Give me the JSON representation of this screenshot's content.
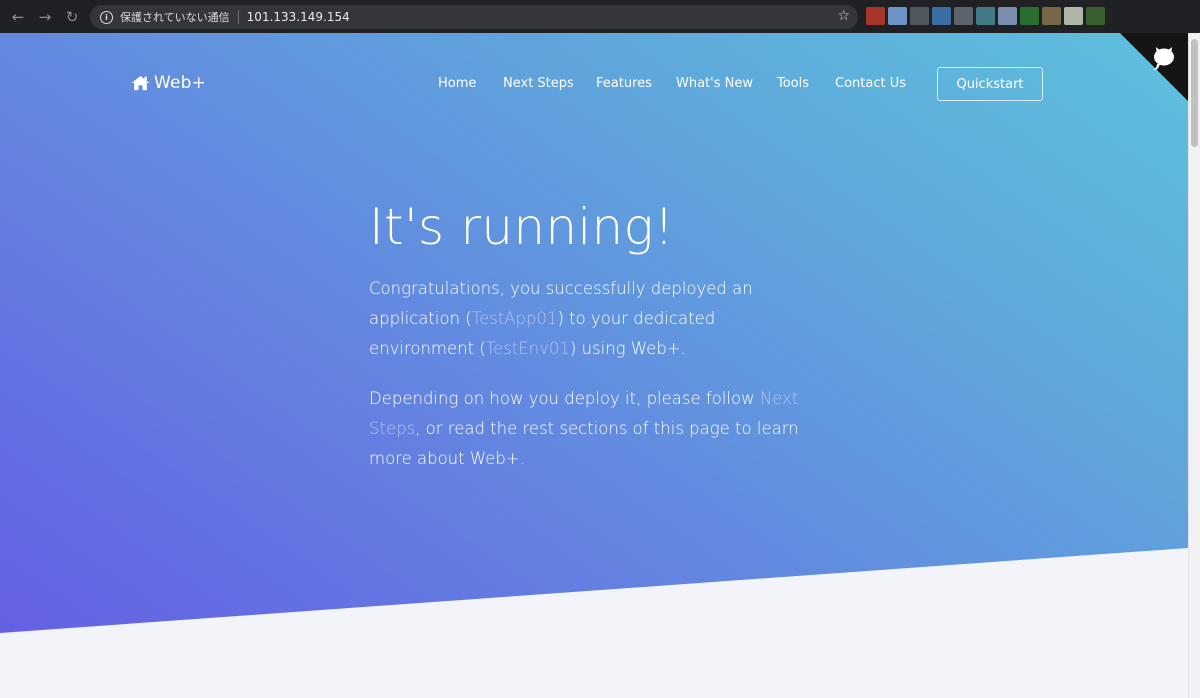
{
  "browser": {
    "security_text": "保護されていない通信",
    "url": "101.133.149.154",
    "extension_colors": [
      "#c0392b",
      "#7aa7e0",
      "#5a5f6a",
      "#3e7bb8",
      "#6a6f78",
      "#4a8a9a",
      "#8aa0c8",
      "#2e7d32",
      "#8a7350",
      "#c8d0c0",
      "#3e6b2e"
    ]
  },
  "nav": {
    "brand": "Web+",
    "links": [
      "Home",
      "Next Steps",
      "Features",
      "What's New",
      "Tools",
      "Contact Us"
    ],
    "quickstart": "Quickstart"
  },
  "hero": {
    "title": "It's running!",
    "p1": {
      "a": "Congratulations, you successfully deployed an application (",
      "app": "TestApp01",
      "b": ") to your dedicated environment (",
      "env": "TestEnv01",
      "c": ") using Web+."
    },
    "p2": {
      "a": "Depending on how you deploy it, please follow ",
      "link": "Next Steps",
      "b": ", or read the rest sections of this page to learn more about Web+."
    }
  },
  "colors": {
    "gradient_start": "#6560e4",
    "gradient_end": "#5ec0dc",
    "highlight": "#b4c2f2",
    "page_bg": "#f3f4f9"
  }
}
